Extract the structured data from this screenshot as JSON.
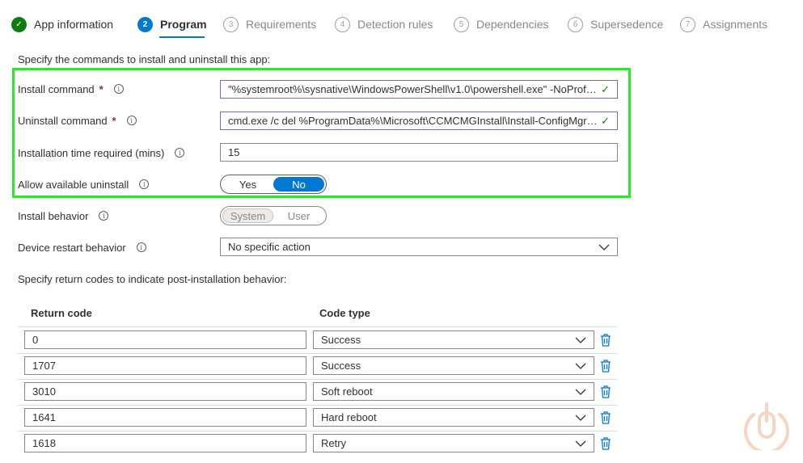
{
  "steps": [
    {
      "label": "App information",
      "state": "done",
      "num": "✓"
    },
    {
      "label": "Program",
      "state": "active",
      "num": "2"
    },
    {
      "label": "Requirements",
      "state": "todo",
      "num": "3"
    },
    {
      "label": "Detection rules",
      "state": "todo",
      "num": "4"
    },
    {
      "label": "Dependencies",
      "state": "todo",
      "num": "5"
    },
    {
      "label": "Supersedence",
      "state": "todo",
      "num": "6"
    },
    {
      "label": "Assignments",
      "state": "todo",
      "num": "7"
    }
  ],
  "intro": "Specify the commands to install and uninstall this app:",
  "install_command": {
    "label": "Install command",
    "required": "*",
    "value": "\"%systemroot%\\sysnative\\WindowsPowerShell\\v1.0\\powershell.exe\" -NoProfile..."
  },
  "uninstall_command": {
    "label": "Uninstall command",
    "required": "*",
    "value": "cmd.exe /c del %ProgramData%\\Microsoft\\CCMCMGInstall\\Install-ConfigMgrC..."
  },
  "install_time": {
    "label": "Installation time required (mins)",
    "value": "15"
  },
  "allow_uninstall": {
    "label": "Allow available uninstall",
    "yes": "Yes",
    "no": "No",
    "selected": "No"
  },
  "install_behavior": {
    "label": "Install behavior",
    "system": "System",
    "user": "User",
    "selected": "System"
  },
  "restart_behavior": {
    "label": "Device restart behavior",
    "value": "No specific action"
  },
  "return_codes": {
    "title": "Specify return codes to indicate post-installation behavior:",
    "col_code": "Return code",
    "col_type": "Code type",
    "rows": [
      {
        "code": "0",
        "type": "Success"
      },
      {
        "code": "1707",
        "type": "Success"
      },
      {
        "code": "3010",
        "type": "Soft reboot"
      },
      {
        "code": "1641",
        "type": "Hard reboot"
      },
      {
        "code": "1618",
        "type": "Retry"
      }
    ]
  },
  "colors": {
    "accent": "#0078d4",
    "success": "#107c10",
    "highlight": "#22ee22",
    "required": "#a4262c"
  }
}
